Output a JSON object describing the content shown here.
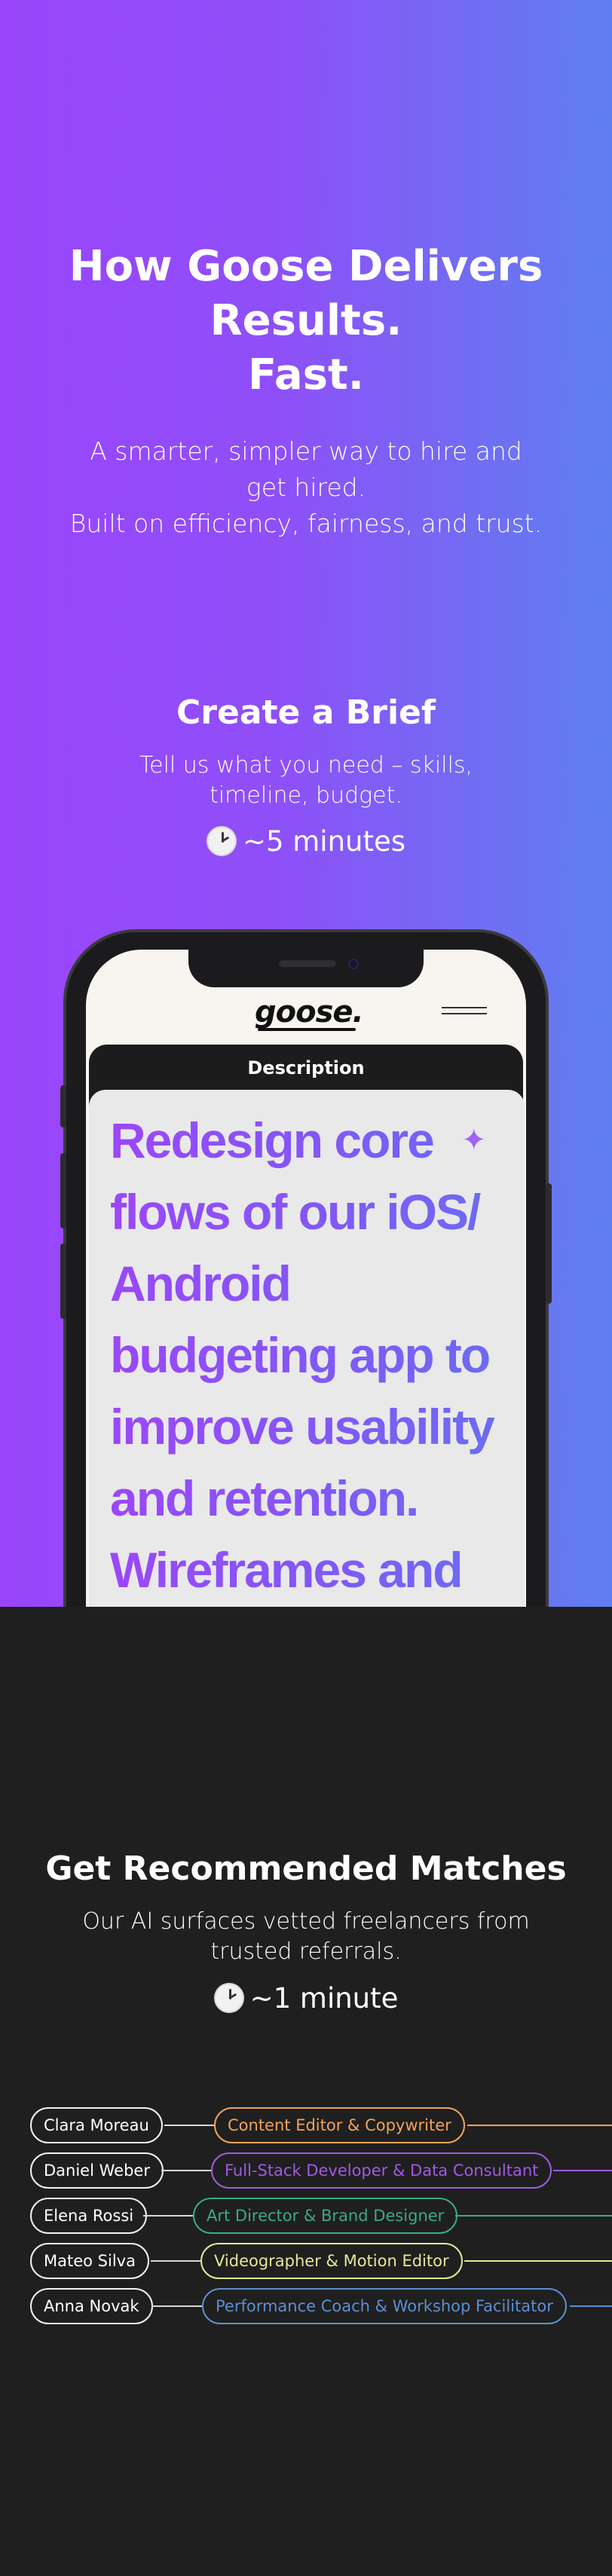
{
  "hero": {
    "title_line1": "How Goose Delivers",
    "title_line2": "Results.",
    "title_line3": "Fast.",
    "subtitle_line1": "A smarter, simpler way to hire and",
    "subtitle_line2": "get hired.",
    "subtitle_line3": "Built on efficiency, fairness, and trust.",
    "gradient_colors": [
      "#9a45fb",
      "#5f7ff1"
    ]
  },
  "step_brief": {
    "title": "Create a Brief",
    "desc_line1": "Tell us what you need – skills,",
    "desc_line2": "timeline, budget.",
    "time": "~5 minutes",
    "time_icon": "clock-icon"
  },
  "phone": {
    "logo": "goose.",
    "menu_icon": "hamburger-menu-icon",
    "card_label": "Description",
    "brief_text": "Redesign core flows of our iOS/ Android budgeting app to improve usability and retention. Wireframes and",
    "sparkle_icon": "sparkle-icon"
  },
  "step_matches": {
    "title": "Get Recommended Matches",
    "desc_line1": "Our AI surfaces vetted freelancers from",
    "desc_line2": "trusted referrals.",
    "time": "~1 minute",
    "time_icon": "clock-icon"
  },
  "matches": [
    {
      "name": "Clara Moreau",
      "role": "Content Editor & Copywriter",
      "color": "#f0a35a"
    },
    {
      "name": "Daniel Weber",
      "role": "Full-Stack Developer & Data Consultant",
      "color": "#a15ae0"
    },
    {
      "name": "Elena Rossi",
      "role": "Art Director & Brand Designer",
      "color": "#3fa887"
    },
    {
      "name": "Mateo Silva",
      "role": "Videographer & Motion Editor",
      "color": "#e6e79a"
    },
    {
      "name": "Anna Novak",
      "role": "Performance Coach & Workshop Facilitator",
      "color": "#5c8fd1"
    }
  ]
}
